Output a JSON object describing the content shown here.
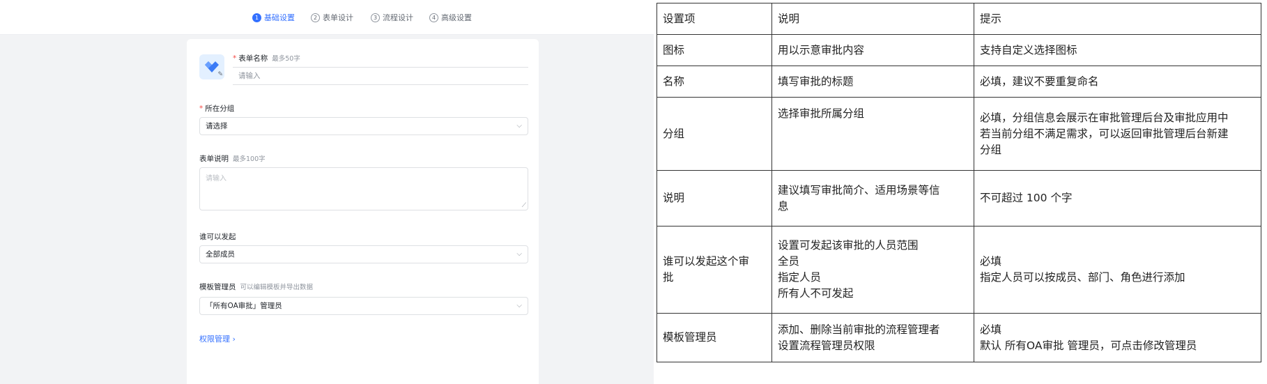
{
  "steps": [
    {
      "num": "1",
      "label": "基础设置",
      "active": true
    },
    {
      "num": "2",
      "label": "表单设计",
      "active": false
    },
    {
      "num": "3",
      "label": "流程设计",
      "active": false
    },
    {
      "num": "4",
      "label": "高级设置",
      "active": false
    }
  ],
  "form": {
    "name_label": "表单名称",
    "name_hint": "最多50字",
    "name_placeholder": "请输入",
    "group_label": "所在分组",
    "group_value": "请选择",
    "desc_label": "表单说明",
    "desc_hint": "最多100字",
    "desc_placeholder": "请输入",
    "initiator_label": "谁可以发起",
    "initiator_value": "全部成员",
    "admin_label": "模板管理员",
    "admin_hint": "可以编辑模板并导出数据",
    "admin_value": "「所有OA审批」管理员",
    "permission_link": "权限管理",
    "permission_arrow": "›"
  },
  "table": {
    "headers": [
      "设置项",
      "说明",
      "提示"
    ],
    "rows": [
      {
        "item": "图标",
        "desc": [
          "用以示意审批内容"
        ],
        "tip": [
          "支持自定义选择图标"
        ]
      },
      {
        "item": "名称",
        "desc": [
          "填写审批的标题"
        ],
        "tip": [
          "必填，建议不要重复命名"
        ]
      },
      {
        "item": "分组",
        "desc": [
          "选择审批所属分组"
        ],
        "tip": [
          "必填，分组信息会展示在审批管理后台及审批应用中",
          "若当前分组不满足需求，可以返回审批管理后台新建",
          "分组"
        ]
      },
      {
        "item": "说明",
        "desc": [
          "建议填写审批简介、适用场景等信",
          "息"
        ],
        "tip": [
          "不可超过 100 个字"
        ]
      },
      {
        "item": "谁可以发起这个审批",
        "item_lines": [
          "谁可以发起这个审",
          "批"
        ],
        "desc": [
          "设置可发起该审批的人员范围",
          "全员",
          "指定人员",
          "所有人不可发起"
        ],
        "tip": [
          "必填",
          "指定人员可以按成员、部门、角色进行添加"
        ]
      },
      {
        "item": "模板管理员",
        "desc": [
          "添加、删除当前审批的流程管理者",
          "设置流程管理员权限"
        ],
        "tip": [
          "必填",
          "默认 所有OA审批 管理员，可点击修改管理员"
        ]
      }
    ]
  },
  "colors": {
    "accent": "#3370ff",
    "required": "#f54a45",
    "icon_bg": "#e3f0ff",
    "icon_fg": "#3b7bf6"
  },
  "icons": [
    "app-icon",
    "edit-icon",
    "chevron-down-icon",
    "chevron-right-icon",
    "resize-handle-icon"
  ]
}
